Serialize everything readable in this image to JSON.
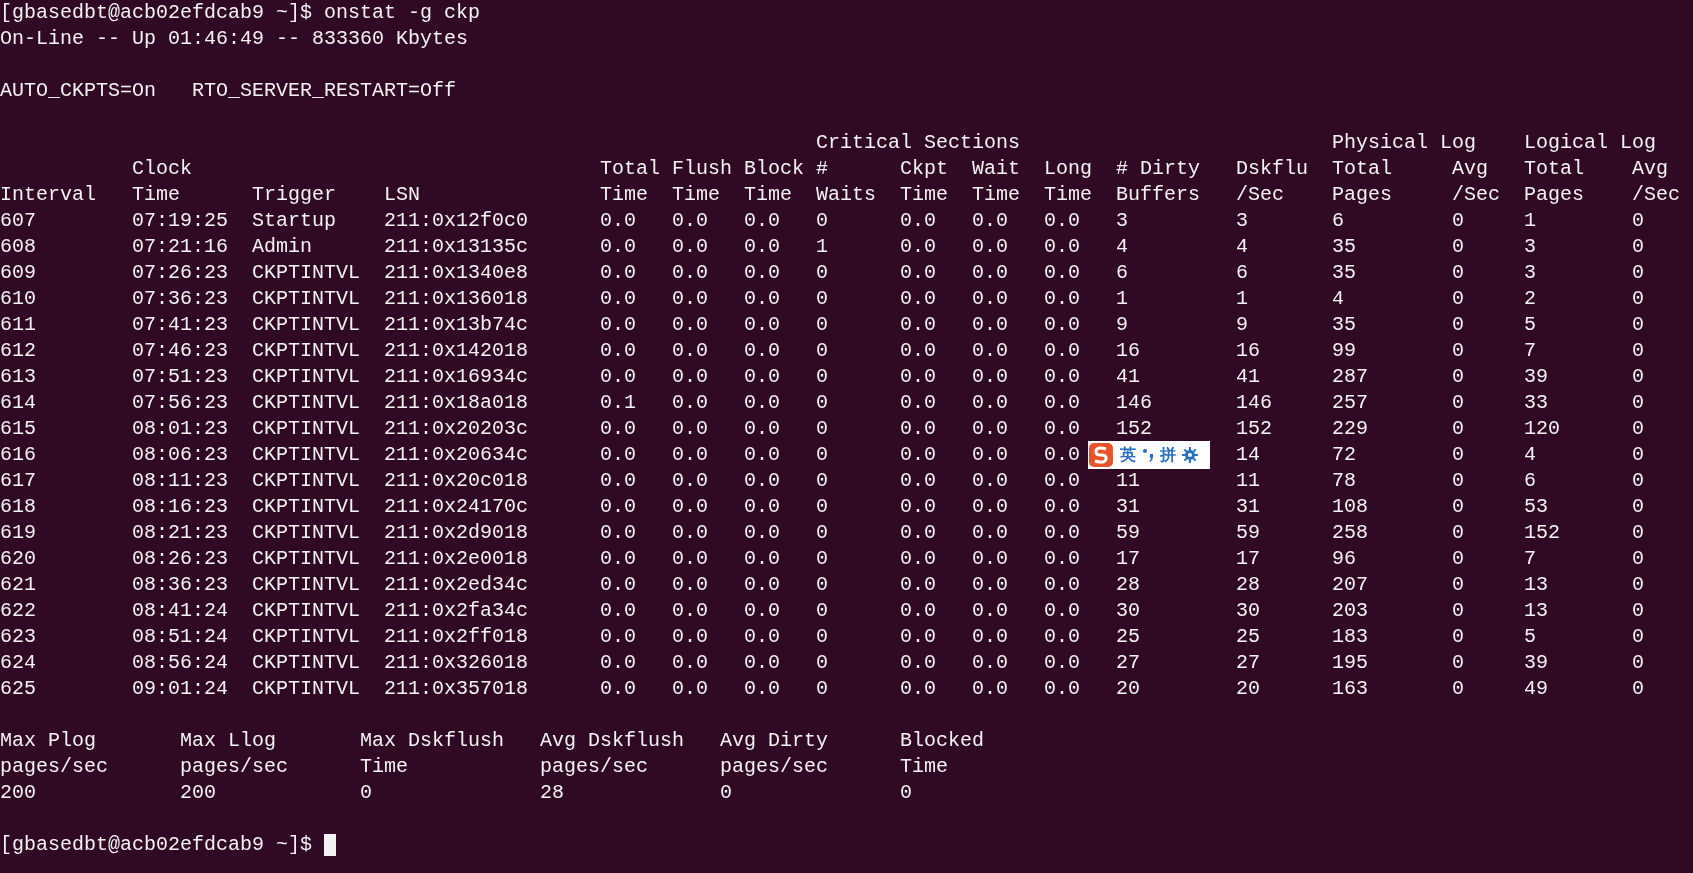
{
  "prompt": {
    "text": "[gbasedbt@acb02efdcab9 ~]$ ",
    "command": "onstat -g ckp"
  },
  "status_line": "On-Line -- Up 01:46:49 -- 833360 Kbytes",
  "settings_line": "AUTO_CKPTS=On   RTO_SERVER_RESTART=Off",
  "table": {
    "groups": [
      {
        "label": "Critical Sections"
      },
      {
        "label": "Physical Log"
      },
      {
        "label": "Logical Log"
      }
    ],
    "columns": [
      {
        "header": [
          "Interval"
        ]
      },
      {
        "header": [
          "Clock",
          "Time"
        ]
      },
      {
        "header": [
          "Trigger"
        ]
      },
      {
        "header": [
          "LSN"
        ]
      },
      {
        "header": [
          "Total",
          "Time"
        ]
      },
      {
        "header": [
          "Flush",
          "Time"
        ]
      },
      {
        "header": [
          "Block",
          "Time"
        ]
      },
      {
        "header": [
          "#",
          "Waits"
        ]
      },
      {
        "header": [
          "Ckpt",
          "Time"
        ]
      },
      {
        "header": [
          "Wait",
          "Time"
        ]
      },
      {
        "header": [
          "Long",
          "Time"
        ]
      },
      {
        "header": [
          "# Dirty",
          "Buffers"
        ]
      },
      {
        "header": [
          "Dskflu",
          "/Sec"
        ]
      },
      {
        "header": [
          "Total",
          "Pages"
        ]
      },
      {
        "header": [
          "Avg",
          "/Sec"
        ]
      },
      {
        "header": [
          "Total",
          "Pages"
        ]
      },
      {
        "header": [
          "Avg",
          "/Sec"
        ]
      }
    ],
    "rows": [
      [
        "607",
        "07:19:25",
        "Startup",
        "211:0x12f0c0",
        "0.0",
        "0.0",
        "0.0",
        "0",
        "0.0",
        "0.0",
        "0.0",
        "3",
        "3",
        "6",
        "0",
        "1",
        "0"
      ],
      [
        "608",
        "07:21:16",
        "Admin",
        "211:0x13135c",
        "0.0",
        "0.0",
        "0.0",
        "1",
        "0.0",
        "0.0",
        "0.0",
        "4",
        "4",
        "35",
        "0",
        "3",
        "0"
      ],
      [
        "609",
        "07:26:23",
        "CKPTINTVL",
        "211:0x1340e8",
        "0.0",
        "0.0",
        "0.0",
        "0",
        "0.0",
        "0.0",
        "0.0",
        "6",
        "6",
        "35",
        "0",
        "3",
        "0"
      ],
      [
        "610",
        "07:36:23",
        "CKPTINTVL",
        "211:0x136018",
        "0.0",
        "0.0",
        "0.0",
        "0",
        "0.0",
        "0.0",
        "0.0",
        "1",
        "1",
        "4",
        "0",
        "2",
        "0"
      ],
      [
        "611",
        "07:41:23",
        "CKPTINTVL",
        "211:0x13b74c",
        "0.0",
        "0.0",
        "0.0",
        "0",
        "0.0",
        "0.0",
        "0.0",
        "9",
        "9",
        "35",
        "0",
        "5",
        "0"
      ],
      [
        "612",
        "07:46:23",
        "CKPTINTVL",
        "211:0x142018",
        "0.0",
        "0.0",
        "0.0",
        "0",
        "0.0",
        "0.0",
        "0.0",
        "16",
        "16",
        "99",
        "0",
        "7",
        "0"
      ],
      [
        "613",
        "07:51:23",
        "CKPTINTVL",
        "211:0x16934c",
        "0.0",
        "0.0",
        "0.0",
        "0",
        "0.0",
        "0.0",
        "0.0",
        "41",
        "41",
        "287",
        "0",
        "39",
        "0"
      ],
      [
        "614",
        "07:56:23",
        "CKPTINTVL",
        "211:0x18a018",
        "0.1",
        "0.0",
        "0.0",
        "0",
        "0.0",
        "0.0",
        "0.0",
        "146",
        "146",
        "257",
        "0",
        "33",
        "0"
      ],
      [
        "615",
        "08:01:23",
        "CKPTINTVL",
        "211:0x20203c",
        "0.0",
        "0.0",
        "0.0",
        "0",
        "0.0",
        "0.0",
        "0.0",
        "152",
        "152",
        "229",
        "0",
        "120",
        "0"
      ],
      [
        "616",
        "08:06:23",
        "CKPTINTVL",
        "211:0x20634c",
        "0.0",
        "0.0",
        "0.0",
        "0",
        "0.0",
        "0.0",
        "0.0",
        null,
        "14",
        "72",
        "0",
        "4",
        "0"
      ],
      [
        "617",
        "08:11:23",
        "CKPTINTVL",
        "211:0x20c018",
        "0.0",
        "0.0",
        "0.0",
        "0",
        "0.0",
        "0.0",
        "0.0",
        "11",
        "11",
        "78",
        "0",
        "6",
        "0"
      ],
      [
        "618",
        "08:16:23",
        "CKPTINTVL",
        "211:0x24170c",
        "0.0",
        "0.0",
        "0.0",
        "0",
        "0.0",
        "0.0",
        "0.0",
        "31",
        "31",
        "108",
        "0",
        "53",
        "0"
      ],
      [
        "619",
        "08:21:23",
        "CKPTINTVL",
        "211:0x2d9018",
        "0.0",
        "0.0",
        "0.0",
        "0",
        "0.0",
        "0.0",
        "0.0",
        "59",
        "59",
        "258",
        "0",
        "152",
        "0"
      ],
      [
        "620",
        "08:26:23",
        "CKPTINTVL",
        "211:0x2e0018",
        "0.0",
        "0.0",
        "0.0",
        "0",
        "0.0",
        "0.0",
        "0.0",
        "17",
        "17",
        "96",
        "0",
        "7",
        "0"
      ],
      [
        "621",
        "08:36:23",
        "CKPTINTVL",
        "211:0x2ed34c",
        "0.0",
        "0.0",
        "0.0",
        "0",
        "0.0",
        "0.0",
        "0.0",
        "28",
        "28",
        "207",
        "0",
        "13",
        "0"
      ],
      [
        "622",
        "08:41:24",
        "CKPTINTVL",
        "211:0x2fa34c",
        "0.0",
        "0.0",
        "0.0",
        "0",
        "0.0",
        "0.0",
        "0.0",
        "30",
        "30",
        "203",
        "0",
        "13",
        "0"
      ],
      [
        "623",
        "08:51:24",
        "CKPTINTVL",
        "211:0x2ff018",
        "0.0",
        "0.0",
        "0.0",
        "0",
        "0.0",
        "0.0",
        "0.0",
        "25",
        "25",
        "183",
        "0",
        "5",
        "0"
      ],
      [
        "624",
        "08:56:24",
        "CKPTINTVL",
        "211:0x326018",
        "0.0",
        "0.0",
        "0.0",
        "0",
        "0.0",
        "0.0",
        "0.0",
        "27",
        "27",
        "195",
        "0",
        "39",
        "0"
      ],
      [
        "625",
        "09:01:24",
        "CKPTINTVL",
        "211:0x357018",
        "0.0",
        "0.0",
        "0.0",
        "0",
        "0.0",
        "0.0",
        "0.0",
        "20",
        "20",
        "163",
        "0",
        "49",
        "0"
      ]
    ]
  },
  "summary": [
    {
      "label": [
        "Max Plog",
        "pages/sec"
      ],
      "value": "200"
    },
    {
      "label": [
        "Max Llog",
        "pages/sec"
      ],
      "value": "200"
    },
    {
      "label": [
        "Max Dskflush",
        "Time"
      ],
      "value": "0"
    },
    {
      "label": [
        "Avg Dskflush",
        "pages/sec"
      ],
      "value": "28"
    },
    {
      "label": [
        "Avg Dirty",
        "pages/sec"
      ],
      "value": "0"
    },
    {
      "label": [
        "Blocked",
        "Time"
      ],
      "value": "0"
    }
  ],
  "final_prompt": "[gbasedbt@acb02efdcab9 ~]$ ",
  "ime_toolbar": {
    "language": "英",
    "mode": "拼"
  }
}
